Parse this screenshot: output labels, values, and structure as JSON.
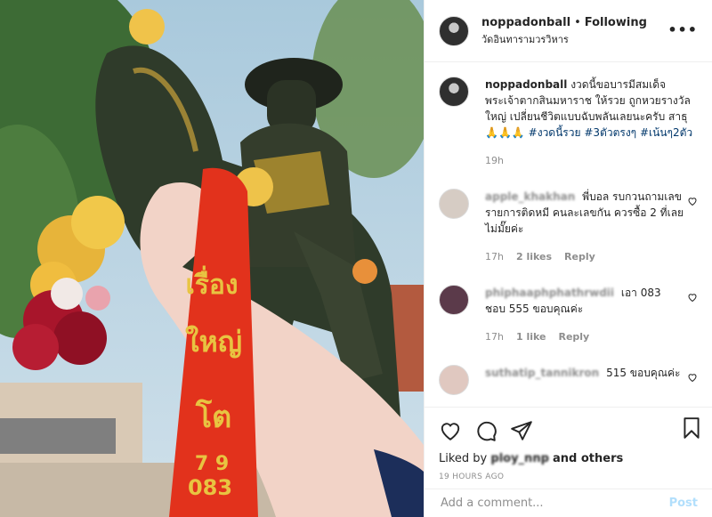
{
  "post": {
    "username": "noppadonball",
    "follow_status": "Following",
    "location": "วัดอินทารามวรวิหาร",
    "more_icon": "more-options-icon",
    "caption": {
      "text": "งวดนี้ขอบารมีสมเด็จพระเจ้าตากสินมหาราช ให้รวย ถูกหวยรางวัลใหญ่ เปลี่ยนชีวิตแบบฉับพลันเลยนะครับ สาธุ 🙏🙏🙏",
      "hashtags": [
        "#งวดนี้รวย",
        "#3ตัวตรงๆ",
        "#เน้นๆ2ตัว"
      ],
      "time": "19h"
    },
    "comments": [
      {
        "username": "apple_khakhan",
        "text": "พี่บอล รบกวนถามเลขรายการติดหมี คนละเลขกัน ควรซื้อ 2 ที่เลยไม่มั๊ยค่ะ",
        "time": "17h",
        "likes": "2 likes",
        "reply": "Reply"
      },
      {
        "username": "phiphaaphphathrwdii",
        "text": "เอา 083 ชอบ 555 ขอบคุณค่ะ",
        "time": "17h",
        "likes": "1 like",
        "reply": "Reply"
      },
      {
        "username": "suthatip_tannikron",
        "text": "515 ขอบคุณค่ะ",
        "time": "",
        "likes": "",
        "reply": ""
      }
    ],
    "likes_prefix": "Liked by",
    "likes_user": "ploy_nnp",
    "likes_suffix": "and others",
    "timestamp": "19 HOURS AGO",
    "comment_placeholder": "Add a comment...",
    "post_button": "Post"
  },
  "photo": {
    "ribbon_lines": [
      "เรื่อง",
      "ใหญ่",
      "โต",
      "7 9",
      "083"
    ]
  }
}
